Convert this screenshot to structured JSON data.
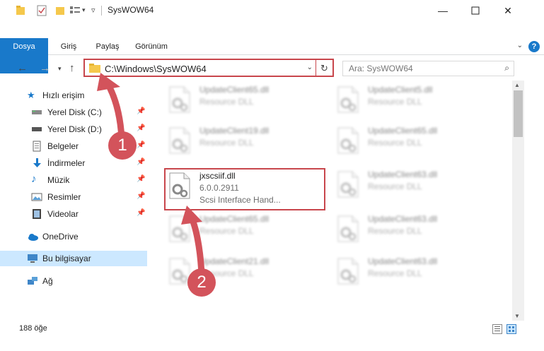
{
  "window": {
    "title": "SysWOW64"
  },
  "ribbon": {
    "tabs": [
      "Dosya",
      "Giriş",
      "Paylaş",
      "Görünüm"
    ],
    "help": "?"
  },
  "address": {
    "path": "C:\\Windows\\SysWOW64",
    "search_placeholder": "Ara: SysWOW64"
  },
  "nav": {
    "quick_access": "Hızlı erişim",
    "items": [
      {
        "label": "Yerel Disk (C:)",
        "icon": "drive-icon"
      },
      {
        "label": "Yerel Disk (D:)",
        "icon": "drive-icon"
      },
      {
        "label": "Belgeler",
        "icon": "documents-icon"
      },
      {
        "label": "İndirmeler",
        "icon": "download-icon"
      },
      {
        "label": "Müzik",
        "icon": "music-icon"
      },
      {
        "label": "Resimler",
        "icon": "pictures-icon"
      },
      {
        "label": "Videolar",
        "icon": "videos-icon"
      }
    ],
    "onedrive": "OneDrive",
    "this_pc": "Bu bilgisayar",
    "network": "Ağ"
  },
  "files": {
    "left": [
      {
        "name": "UpdateClient65.dll",
        "l2": "Resource DLL",
        "l3": ""
      },
      {
        "name": "UpdateClient19.dll",
        "l2": "Resource DLL",
        "l3": ""
      },
      {
        "name": "jxscsiif.dll",
        "l2": "6.0.0.2911",
        "l3": "Scsi Interface Hand..."
      },
      {
        "name": "UpdateClient65.dll",
        "l2": "Resource DLL",
        "l3": ""
      },
      {
        "name": "UpdateClient21.dll",
        "l2": "Resource DLL",
        "l3": ""
      }
    ],
    "right": [
      {
        "name": "UpdateClient5.dll",
        "l2": "Resource DLL"
      },
      {
        "name": "UpdateClient65.dll",
        "l2": "Resource DLL"
      },
      {
        "name": "UpdateClient63.dll",
        "l2": "Resource DLL"
      },
      {
        "name": "UpdateClient63.dll",
        "l2": "Resource DLL"
      },
      {
        "name": "UpdateClient63.dll",
        "l2": "Resource DLL"
      }
    ]
  },
  "status": {
    "count": "188 öğe"
  },
  "annotations": {
    "badge1": "1",
    "badge2": "2"
  },
  "colors": {
    "accent": "#1979ca",
    "highlight": "#c8464c",
    "badge": "#d3535b",
    "selected": "#cce8ff"
  }
}
